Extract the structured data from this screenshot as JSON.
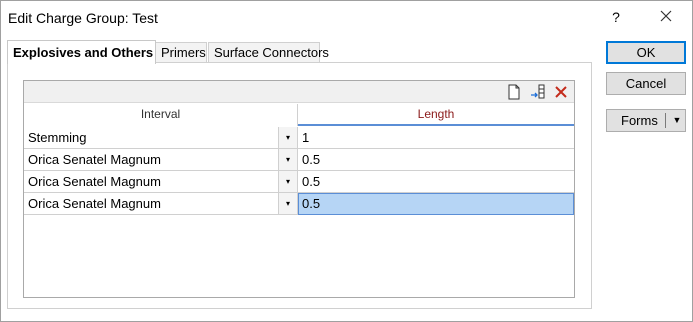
{
  "window": {
    "title": "Edit Charge Group: Test",
    "help_label": "?",
    "close_icon": "close-icon"
  },
  "tabs": [
    {
      "label": "Explosives and Others",
      "active": true
    },
    {
      "label": "Primers",
      "active": false
    },
    {
      "label": "Surface Connectors",
      "active": false
    }
  ],
  "toolbar": {
    "icons": [
      "new-row-icon",
      "insert-row-icon",
      "delete-row-icon"
    ]
  },
  "grid": {
    "columns": [
      "Interval",
      "Length"
    ],
    "rows": [
      {
        "interval": "Stemming",
        "length": "1"
      },
      {
        "interval": "Orica Senatel Magnum",
        "length": "0.5"
      },
      {
        "interval": "Orica Senatel Magnum",
        "length": "0.5"
      },
      {
        "interval": "Orica Senatel Magnum",
        "length": "0.5",
        "selected": true
      }
    ],
    "dropdown_glyph": "▾"
  },
  "buttons": {
    "ok": "OK",
    "cancel": "Cancel",
    "forms": "Forms",
    "forms_arrow": "▼"
  },
  "colors": {
    "selection": "#b6d5f5",
    "length_header": "#8b1a1a",
    "ok_border": "#0078d7",
    "delete_icon": "#c42b1c"
  }
}
